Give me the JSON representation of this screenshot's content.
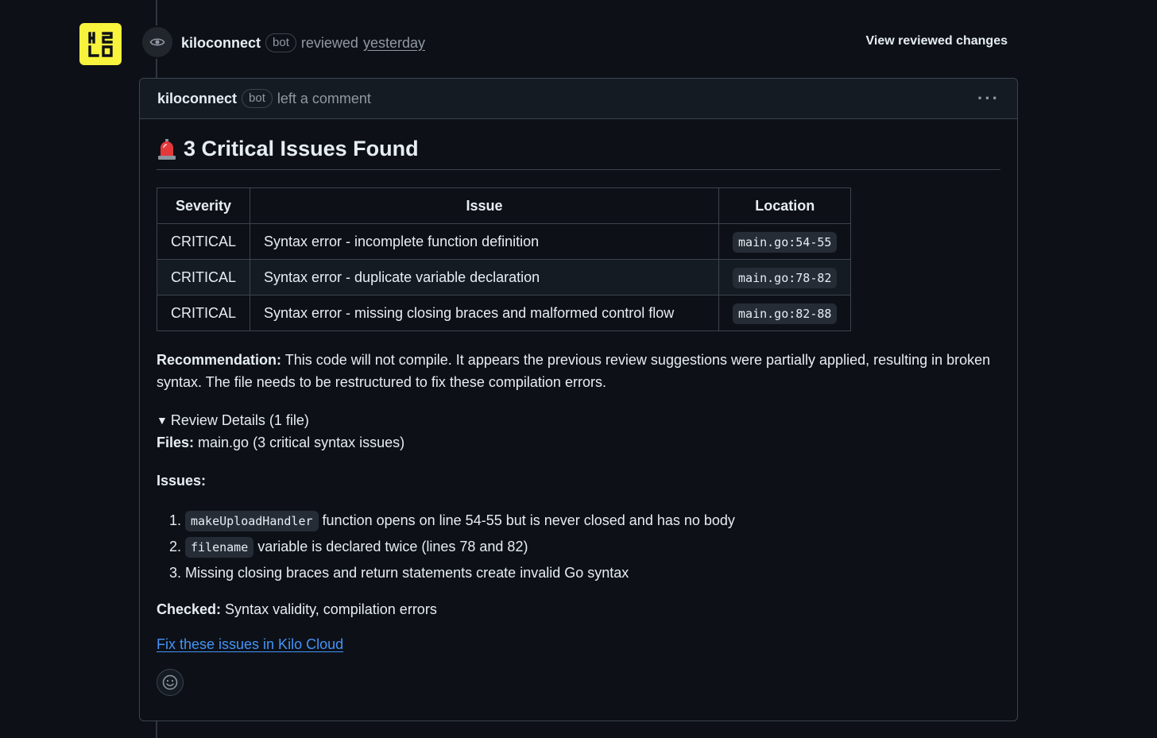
{
  "review": {
    "author": "kiloconnect",
    "bot_badge": "bot",
    "action": "reviewed",
    "time": "yesterday",
    "view_changes": "View reviewed changes"
  },
  "comment": {
    "author": "kiloconnect",
    "bot_badge": "bot",
    "action": "left a comment",
    "menu_icon": "kebab-horizontal-icon",
    "title": "3 Critical Issues Found",
    "title_icon": "rotating-light-emoji",
    "table": {
      "headers": [
        "Severity",
        "Issue",
        "Location"
      ],
      "rows": [
        [
          "CRITICAL",
          "Syntax error - incomplete function definition",
          "main.go:54-55"
        ],
        [
          "CRITICAL",
          "Syntax error - duplicate variable declaration",
          "main.go:78-82"
        ],
        [
          "CRITICAL",
          "Syntax error - missing closing braces and malformed control flow",
          "main.go:82-88"
        ]
      ]
    },
    "recommendation_label": "Recommendation:",
    "recommendation_text": "This code will not compile. It appears the previous review suggestions were partially applied, resulting in broken syntax. The file needs to be restructured to fix these compilation errors.",
    "details_summary": "Review Details (1 file)",
    "files_label": "Files:",
    "files_text": "main.go (3 critical syntax issues)",
    "issues_label": "Issues:",
    "issues_list": [
      {
        "code": "makeUploadHandler",
        "text": "function opens on line 54-55 but is never closed and has no body"
      },
      {
        "code": "filename",
        "text": "variable is declared twice (lines 78 and 82)"
      },
      {
        "code": "",
        "text": "Missing closing braces and return statements create invalid Go syntax"
      }
    ],
    "checked_label": "Checked:",
    "checked_text": "Syntax validity, compilation errors",
    "fix_link": "Fix these issues in Kilo Cloud",
    "reaction_icon": "smiley-icon"
  },
  "colors": {
    "background": "#0d1117",
    "link": "#4493f8",
    "avatar": "#f8f33c"
  }
}
